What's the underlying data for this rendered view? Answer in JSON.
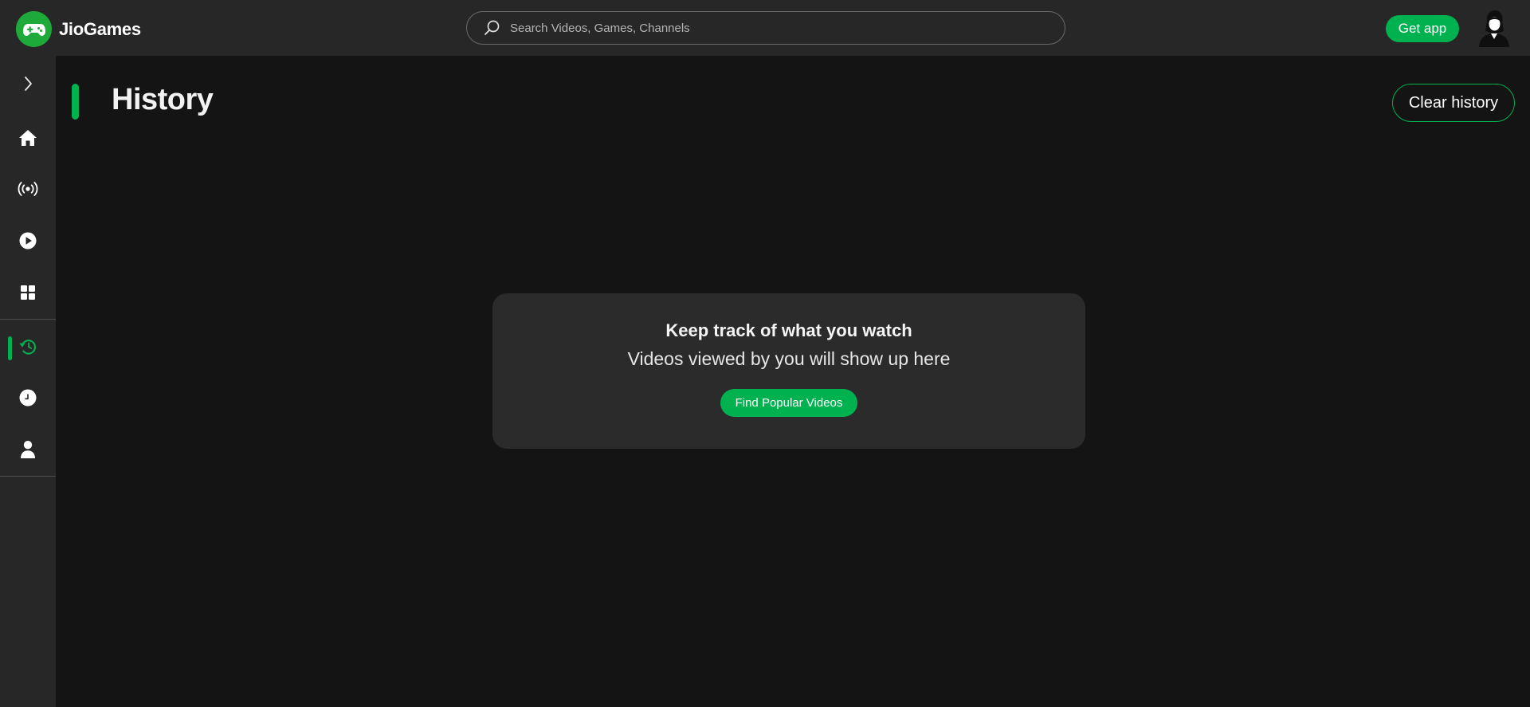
{
  "app": {
    "name": "JioGames",
    "logo_icon": "gamepad-icon",
    "brand_color": "#00b14f"
  },
  "header": {
    "search": {
      "placeholder": "Search Videos, Games, Channels",
      "value": "",
      "icon": "search-icon"
    },
    "get_app_label": "Get app",
    "avatar_icon": "user-avatar-icon"
  },
  "sidebar": {
    "items": [
      {
        "name": "expand",
        "icon": "chevron-right-icon",
        "active": false
      },
      {
        "name": "home",
        "icon": "home-icon",
        "active": false
      },
      {
        "name": "live",
        "icon": "broadcast-icon",
        "active": false
      },
      {
        "name": "videos",
        "icon": "play-icon",
        "active": false
      },
      {
        "name": "categories",
        "icon": "grid-icon",
        "active": false
      },
      {
        "name": "history",
        "icon": "history-icon",
        "active": true
      },
      {
        "name": "watch-later",
        "icon": "clock-icon",
        "active": false
      },
      {
        "name": "profile",
        "icon": "user-icon",
        "active": false
      }
    ]
  },
  "main": {
    "title": "History",
    "clear_label": "Clear history",
    "empty_state": {
      "title": "Keep track of what you watch",
      "subtitle": "Videos viewed by you will show up here",
      "button_label": "Find Popular Videos"
    }
  }
}
